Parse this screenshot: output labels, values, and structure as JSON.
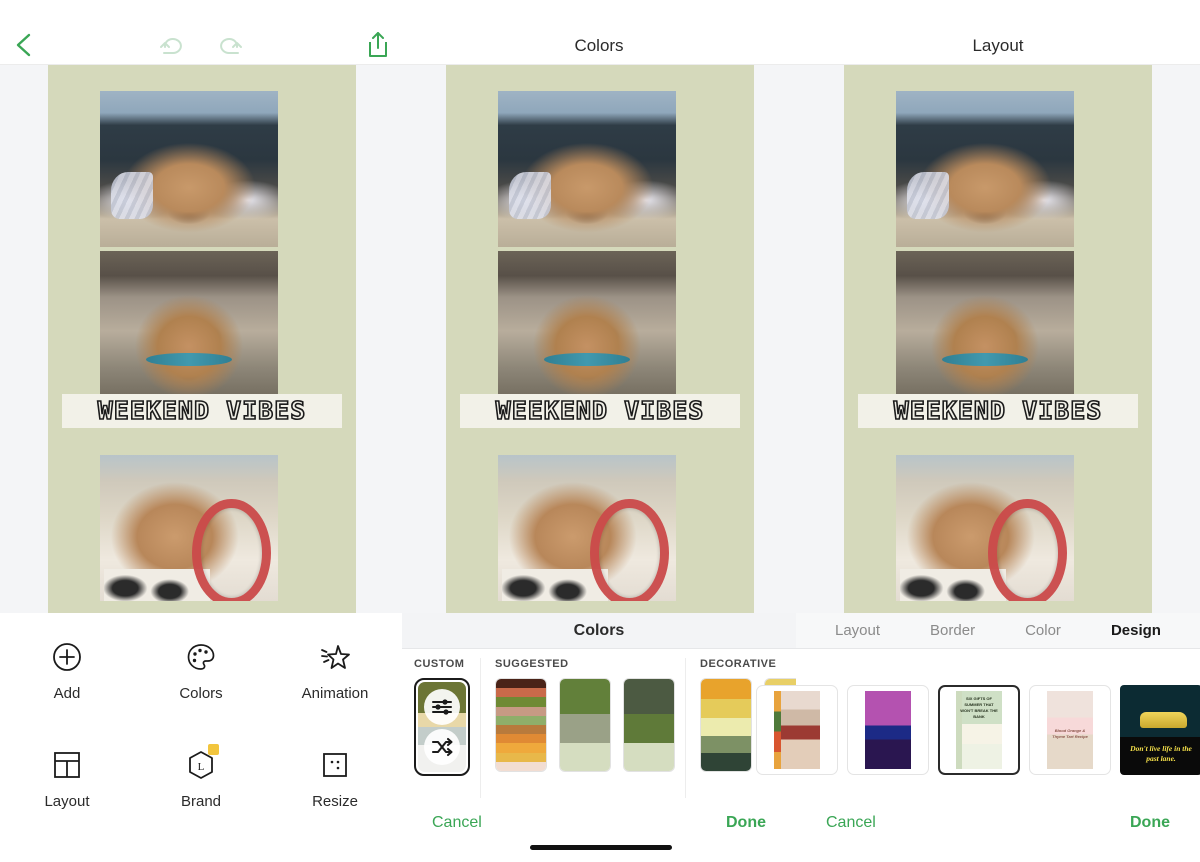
{
  "app": {
    "artboard_bg": "#d5d9bb",
    "accent_green": "#3aa655"
  },
  "editor_panel": {
    "topbar": {
      "back_icon": "chevron-left-icon",
      "undo_icon": "undo-icon",
      "redo_icon": "redo-icon",
      "share_icon": "share-export-icon"
    },
    "canvas": {
      "headline": "WEEKEND VIBES",
      "photos": [
        "sleeping-puppy-on-chair",
        "puppy-looking-up",
        "puppy-with-red-toy"
      ]
    },
    "tools": [
      {
        "label": "Add",
        "icon": "plus-circle-icon"
      },
      {
        "label": "Colors",
        "icon": "palette-icon"
      },
      {
        "label": "Animation",
        "icon": "sparkle-star-icon"
      },
      {
        "label": "Layout",
        "icon": "grid-layout-icon"
      },
      {
        "label": "Brand",
        "icon": "brand-hexagon-icon"
      },
      {
        "label": "Resize",
        "icon": "resize-icon"
      }
    ]
  },
  "colors_panel": {
    "title": "Colors",
    "section_bar": "Colors",
    "groups": [
      {
        "label": "CUSTOM",
        "type": "custom",
        "sliders_icon": "sliders-icon",
        "shuffle_icon": "shuffle-icon",
        "bands": [
          "#6c7535",
          "#e8d8a8",
          "#c3cdca",
          "#f1f1ef"
        ]
      },
      {
        "label": "SUGGESTED",
        "type": "palettes",
        "swatches": [
          {
            "colors": [
              "#4a2318",
              "#c96a4a",
              "#6f8a34",
              "#c79a84",
              "#8fae6a",
              "#b87a3c",
              "#e08a34",
              "#efa93c",
              "#e8b84a",
              "#f2ddd2"
            ]
          },
          {
            "colors": [
              "#62803a",
              "#9aa187",
              "#d5ddc0"
            ]
          },
          {
            "colors": [
              "#4c5a42",
              "#5f7a39",
              "#d5ddc0"
            ]
          }
        ]
      },
      {
        "label": "DECORATIVE",
        "type": "palettes",
        "swatches": [
          {
            "colors": [
              "#e8a32c",
              "#e5cb5a",
              "#ecebae",
              "#7d9165",
              "#2f4436"
            ]
          },
          {
            "colors": [
              "#e8cf66",
              "#74a04a",
              "#4f9b84",
              "#e2704a",
              "#eda95e"
            ]
          }
        ],
        "preview_thumb": {
          "colors": [
            "#efe2dc",
            "#d9c6b8",
            "#9c3a33",
            "#e3cdb9"
          ]
        }
      }
    ],
    "actions": {
      "cancel": "Cancel",
      "done": "Done"
    }
  },
  "layout_panel": {
    "title": "Layout",
    "tabs": [
      {
        "label": "Layout",
        "active": false
      },
      {
        "label": "Border",
        "active": false
      },
      {
        "label": "Color",
        "active": false
      },
      {
        "label": "Design",
        "active": true
      }
    ],
    "templates": [
      {
        "name": "food-collage-template",
        "selected": false
      },
      {
        "name": "purple-fashion-template",
        "selected": false
      },
      {
        "name": "green-botanical-template",
        "selected": true,
        "text": "SIX GIFTS OF SUMMER THAT WON'T BREAK THE BANK"
      },
      {
        "name": "dessert-recipe-template",
        "selected": false,
        "text": "Blood Orange & Thyme Tart Recipe"
      },
      {
        "name": "retro-taxi-template",
        "selected": false,
        "text": "Don't live life in the past lane."
      }
    ],
    "actions": {
      "cancel": "Cancel",
      "done": "Done"
    }
  }
}
